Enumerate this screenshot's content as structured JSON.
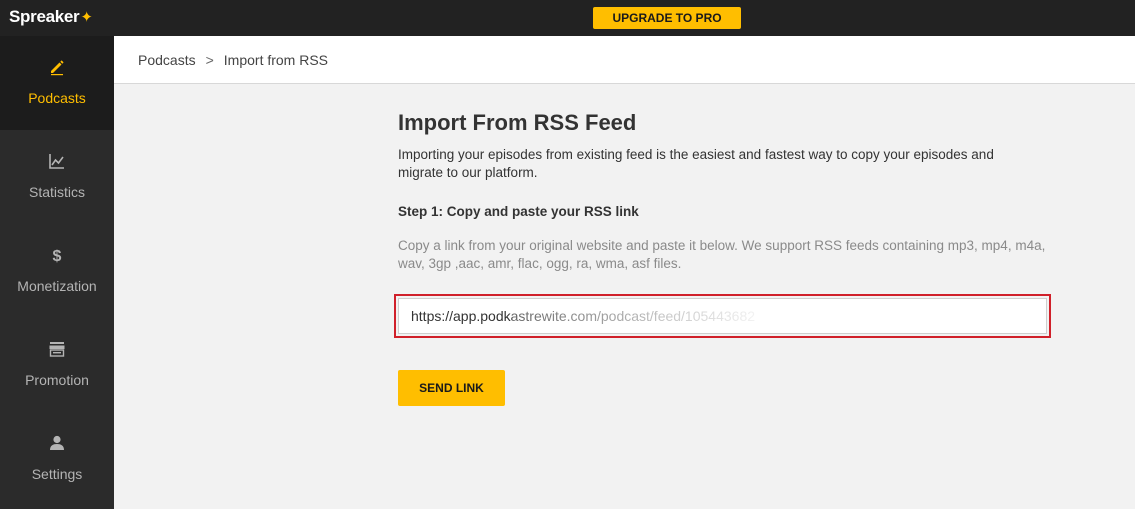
{
  "app": {
    "logo_text": "Spreaker",
    "logo_star": "✦"
  },
  "topbar": {
    "upgrade_label": "UPGRADE TO PRO"
  },
  "sidebar": {
    "items": [
      {
        "label": "Podcasts",
        "icon": "pencil-icon",
        "active": true
      },
      {
        "label": "Statistics",
        "icon": "chart-icon",
        "active": false
      },
      {
        "label": "Monetization",
        "icon": "dollar-icon",
        "active": false
      },
      {
        "label": "Promotion",
        "icon": "storefront-icon",
        "active": false
      },
      {
        "label": "Settings",
        "icon": "user-icon",
        "active": false
      }
    ]
  },
  "breadcrumb": {
    "parent": "Podcasts",
    "separator": ">",
    "current": "Import from RSS"
  },
  "main": {
    "title": "Import From RSS Feed",
    "description": "Importing your episodes from existing feed is the easiest and fastest way to copy your episodes and migrate to our platform.",
    "step_title": "Step 1: Copy and paste your RSS link",
    "hint": "Copy a link from your original website and paste it below. We support RSS feeds containing mp3, mp4, m4a, wav, 3gp ,aac, amr, flac, ogg, ra, wma, asf files.",
    "rss_input_value": "https://app.podkastrewite.com/podcast/feed/105443682",
    "send_label": "SEND LINK"
  },
  "colors": {
    "accent": "#ffbe00",
    "sidebar_bg": "#2b2b2b",
    "topbar_bg": "#222222",
    "highlight": "#d0202a"
  }
}
